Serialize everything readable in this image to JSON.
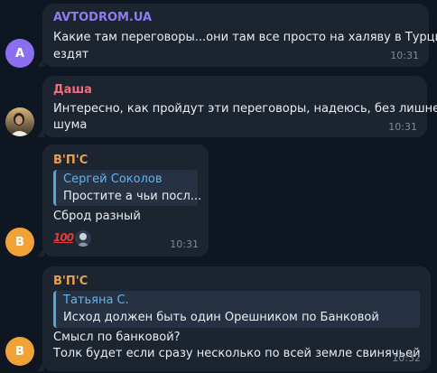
{
  "messages": [
    {
      "avatar_letter": "A",
      "sender": "AVTODROM.UA",
      "sender_color": "#8f7cf0",
      "lines": [
        "Какие там переговоры...они там все просто на халяву в Турцию",
        "ездят"
      ],
      "time": "10:31"
    },
    {
      "sender": "Даша",
      "sender_color": "#ef6d7c",
      "lines": [
        "Интересно, как пройдут эти переговоры, надеюсь, без лишнего",
        "шума"
      ],
      "time": "10:31"
    },
    {
      "avatar_letter": "В",
      "sender": "В'П'С",
      "sender_color": "#e6a052",
      "quote": {
        "name": "Сергей Соколов",
        "text": "Простите а чьи посл..."
      },
      "lines": [
        "Сброд разный"
      ],
      "reactions": [
        "100"
      ],
      "time": "10:31"
    },
    {
      "avatar_letter": "В",
      "sender": "В'П'С",
      "sender_color": "#e6a052",
      "quote": {
        "name": "Татьяна С.",
        "text": "Исход должен быть один Орешником по Банковой"
      },
      "lines": [
        "Смысл по банковой?",
        "Толк будет если сразу несколько по всей земле свинячьей"
      ],
      "time": "10:32"
    }
  ],
  "colors": {
    "background": "#0e1621",
    "bubble": "#1c2430",
    "avatar_purple": "#8a6ff0",
    "avatar_orange": "#f0a237",
    "quote_accent": "#4fa9d8",
    "timestamp": "#7f8b96"
  }
}
